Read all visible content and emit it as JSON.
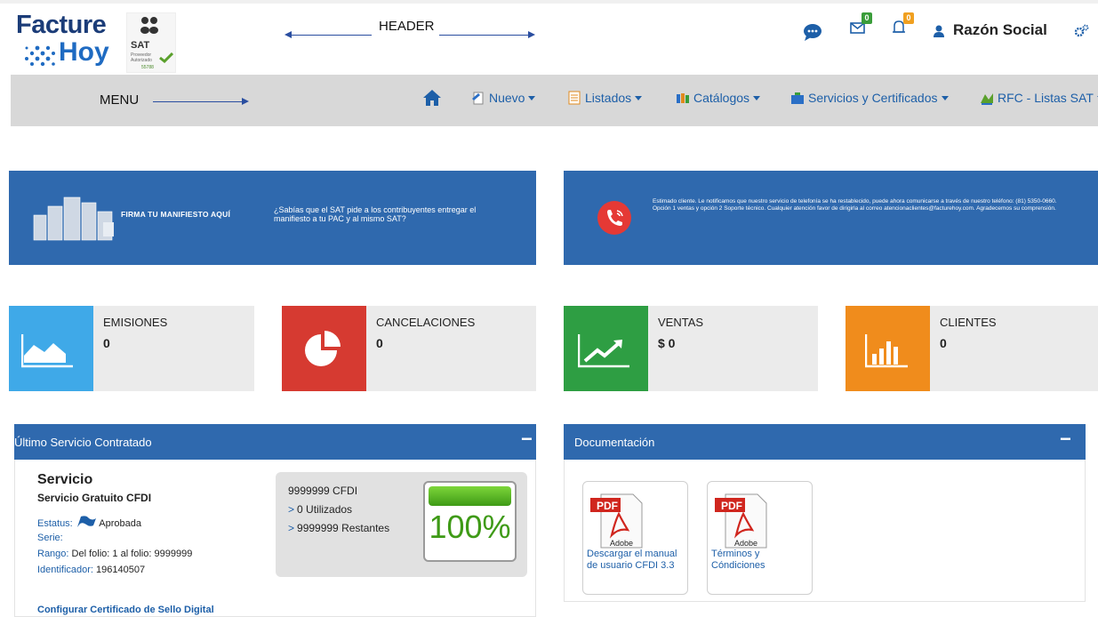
{
  "header": {
    "logo_line1": "Facture",
    "logo_line2": "Hoy",
    "sat_text": "SAT",
    "sat_sub": "Proveedor Autorizado",
    "sat_num": "55788",
    "annotation": "HEADER",
    "messages_badge": "",
    "mail_badge": "0",
    "alerts_badge": "0",
    "user_name": "Razón Social"
  },
  "menu": {
    "annotation": "MENU",
    "items": [
      {
        "label": "Nuevo"
      },
      {
        "label": "Listados"
      },
      {
        "label": "Catálogos"
      },
      {
        "label": "Servicios y Certificados"
      },
      {
        "label": "RFC - Listas SAT"
      }
    ]
  },
  "banners": {
    "left_title": "FIRMA TU MANIFIESTO AQUÍ",
    "left_message": "¿Sabías que el SAT pide a los contribuyentes entregar el manifiesto a tu PAC y al mismo SAT?",
    "right_notice": "Estimado cliente. Le notificamos que nuestro servicio de telefonía se ha restablecido, puede ahora comunicarse a través de nuestro teléfono: (81) 5350-0660. Opción 1 ventas y opción 2 Soporte técnico. Cualquier atención favor de dirigirla al correo atencionaclientes@facturehoy.com. Agradecemos su comprensión."
  },
  "stats": [
    {
      "label": "EMISIONES",
      "value": "0",
      "color": "#3fa9e8"
    },
    {
      "label": "CANCELACIONES",
      "value": "0",
      "color": "#d63a31"
    },
    {
      "label": "VENTAS",
      "value": "$ 0",
      "color": "#2e9e43"
    },
    {
      "label": "CLIENTES",
      "value": "0",
      "color": "#f08c1c"
    }
  ],
  "service_panel": {
    "title": "Último Servicio Contratado",
    "heading": "Servicio",
    "name": "Servicio Gratuito CFDI",
    "status_label": "Estatus:",
    "status_value": "Aprobada",
    "serie_label": "Serie:",
    "serie_value": "",
    "rango_label": "Rango:",
    "rango_value": "Del folio: 1 al folio: 9999999",
    "id_label": "Identificador:",
    "id_value": "196140507",
    "link": "Configurar Certificado de Sello Digital",
    "cfdi_total": "9999999 CFDI",
    "used": "0 Utilizados",
    "remaining": "9999999 Restantes",
    "percent_label": "100%",
    "percent_value": 100
  },
  "docs_panel": {
    "title": "Documentación",
    "pdf_label": "PDF",
    "adobe_label": "Adobe",
    "docs": [
      {
        "label": "Descargar el manual de usuario CFDI 3.3"
      },
      {
        "label": "Términos y Cóndiciones"
      }
    ]
  },
  "colors": {
    "brand_blue": "#2f69ae",
    "link_blue": "#1d5fa8",
    "menu_bg": "#d8d8d8"
  }
}
